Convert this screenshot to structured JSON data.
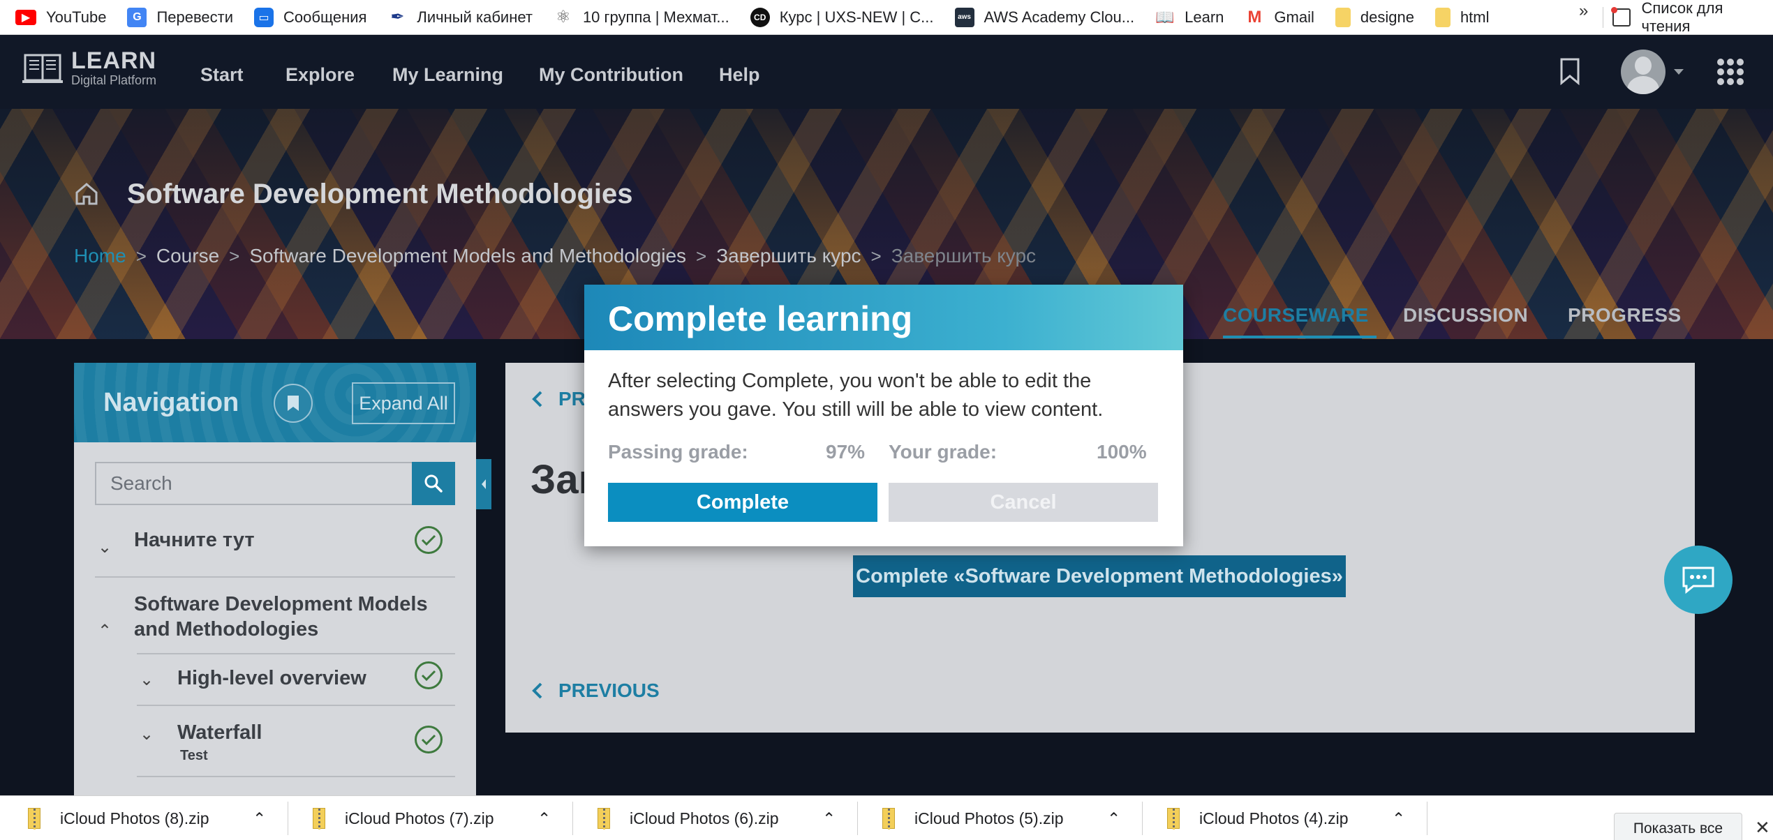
{
  "bookmarks": [
    {
      "label": "YouTube",
      "icon": "youtube-icon",
      "color": "#ff0000"
    },
    {
      "label": "Перевести",
      "icon": "translate-icon",
      "color": "#4285f4"
    },
    {
      "label": "Сообщения",
      "icon": "messages-icon",
      "color": "#1a73e8"
    },
    {
      "label": "Личный кабинет",
      "icon": "feather-icon",
      "color": "#1d3a8a"
    },
    {
      "label": "10 группа | Мехмат...",
      "icon": "atom-icon",
      "color": "#555555"
    },
    {
      "label": "Курс | UXS-NEW | C...",
      "icon": "cd-icon",
      "color": "#111111"
    },
    {
      "label": "AWS Academy Clou...",
      "icon": "aws-icon",
      "color": "#232f3e"
    },
    {
      "label": "Learn",
      "icon": "book-icon",
      "color": "#1d5a8a"
    },
    {
      "label": "Gmail",
      "icon": "gmail-icon",
      "color": "#ea4335"
    },
    {
      "label": "designe",
      "icon": "folder-icon",
      "color": "#f6d365"
    },
    {
      "label": "html",
      "icon": "folder-icon",
      "color": "#f6d365"
    }
  ],
  "bookmarks_more": "»",
  "reading_list": "Список для чтения",
  "logo": {
    "title": "LEARN",
    "subtitle": "Digital Platform"
  },
  "nav": {
    "start": "Start",
    "explore": "Explore",
    "my_learning": "My Learning",
    "my_contribution": "My Contribution",
    "help": "Help"
  },
  "course": {
    "title": "Software Development Methodologies"
  },
  "breadcrumb": {
    "home": "Home",
    "course": "Course",
    "section": "Software Development Models and Methodologies",
    "subsection": "Завершить курс",
    "current": "Завершить курс",
    "separator": ">"
  },
  "tabs": {
    "courseware": "COURSEWARE",
    "discussion": "DISCUSSION",
    "progress": "PROGRESS"
  },
  "sidebar": {
    "title": "Navigation",
    "expand_all": "Expand All",
    "search_placeholder": "Search",
    "items": [
      {
        "label": "Начните тут"
      },
      {
        "label": "Software Development Models and Methodologies"
      },
      {
        "label": "High-level overview"
      },
      {
        "label": "Waterfall",
        "sub": "Test"
      }
    ]
  },
  "content": {
    "previous_top": "PR",
    "heading": "Зав",
    "complete_course_button": "Complete  «Software Development Methodologies»",
    "previous_bottom": "PREVIOUS"
  },
  "modal": {
    "title": "Complete learning",
    "text": "After selecting Complete, you won't be able to edit the answers you gave. You still will be able to view content.",
    "passing_label": "Passing grade:",
    "passing_value": "97%",
    "your_label": "Your grade:",
    "your_value": "100%",
    "complete_button": "Complete",
    "cancel_button": "Cancel"
  },
  "downloads": {
    "items": [
      "iCloud Photos (8).zip",
      "iCloud Photos (7).zip",
      "iCloud Photos (6).zip",
      "iCloud Photos (5).zip",
      "iCloud Photos (4).zip"
    ],
    "show_all": "Показать все"
  },
  "colors": {
    "accent": "#1d7ea3",
    "modal_header": "#2ba0c8",
    "complete_button": "#0b8ec0",
    "check": "#3e7a3e"
  }
}
